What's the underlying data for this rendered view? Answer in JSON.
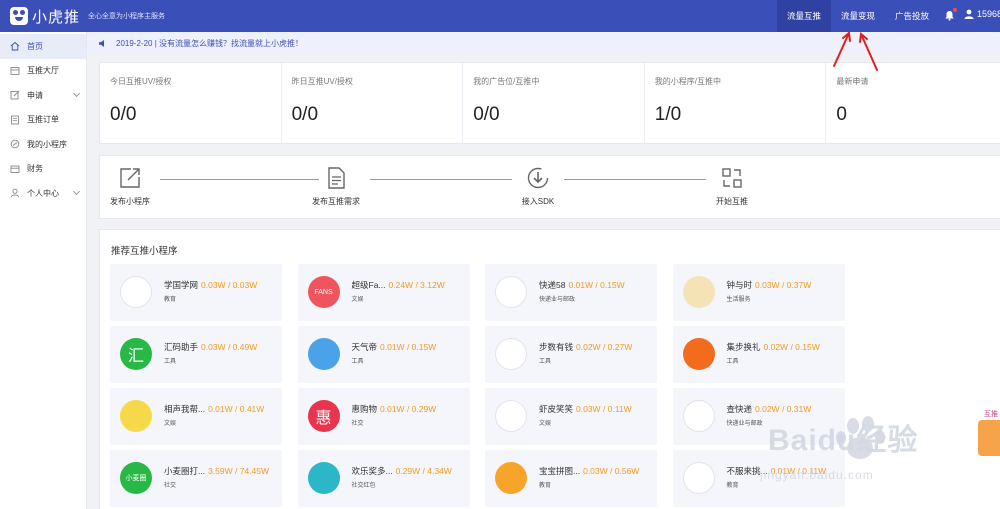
{
  "header": {
    "logo_text": "小虎推",
    "slogan": "全心全意为小程序主服务",
    "nav": [
      "流量互推",
      "流量变现",
      "广告投放"
    ],
    "user_id": "15968"
  },
  "sidebar": {
    "items": [
      {
        "label": "首页",
        "icon": "home-icon"
      },
      {
        "label": "互推大厅",
        "icon": "hall-icon"
      },
      {
        "label": "申请",
        "icon": "edit-icon"
      },
      {
        "label": "互推订单",
        "icon": "order-icon"
      },
      {
        "label": "我的小程序",
        "icon": "miniprogram-icon"
      },
      {
        "label": "财务",
        "icon": "finance-icon"
      },
      {
        "label": "个人中心",
        "icon": "user-icon"
      }
    ]
  },
  "notice": {
    "text": "2019-2-20 | 没有流量怎么赚钱？找流量就上小虎推！"
  },
  "stats": [
    {
      "label": "今日互推UV/授权",
      "value": "0/0"
    },
    {
      "label": "昨日互推UV/授权",
      "value": "0/0"
    },
    {
      "label": "我的广告位/互推中",
      "value": "0/0"
    },
    {
      "label": "我的小程序/互推中",
      "value": "1/0"
    },
    {
      "label": "最新申请",
      "value": "0"
    }
  ],
  "steps": [
    {
      "label": "发布小程序",
      "icon": "publish-icon"
    },
    {
      "label": "发布互推需求",
      "icon": "document-icon"
    },
    {
      "label": "接入SDK",
      "icon": "download-icon"
    },
    {
      "label": "开始互推",
      "icon": "exchange-icon"
    }
  ],
  "recommend": {
    "title": "推荐互推小程序",
    "cards": [
      {
        "name": "学国学网",
        "stats": "0.03W / 0.03W",
        "category": "教育",
        "icon_text": "",
        "color": "#ffffff"
      },
      {
        "name": "超级Fa...",
        "stats": "0.24W / 3.12W",
        "category": "文娱",
        "icon_text": "FANS",
        "color": "#f0555f"
      },
      {
        "name": "快递58",
        "stats": "0.01W / 0.15W",
        "category": "快递业与邮政",
        "icon_text": "",
        "color": "#ffffff"
      },
      {
        "name": "钟与时",
        "stats": "0.03W / 0.37W",
        "category": "生活服务",
        "icon_text": "",
        "color": "#f4e3b5"
      },
      {
        "name": "汇码助手",
        "stats": "0.03W / 0.49W",
        "category": "工具",
        "icon_text": "汇",
        "color": "#27b845"
      },
      {
        "name": "天气帝",
        "stats": "0.01W / 0.15W",
        "category": "工具",
        "icon_text": "",
        "color": "#4aa3e8"
      },
      {
        "name": "步数有钱",
        "stats": "0.02W / 0.27W",
        "category": "工具",
        "icon_text": "",
        "color": "#ffffff"
      },
      {
        "name": "集步换礼",
        "stats": "0.02W / 0.15W",
        "category": "工具",
        "icon_text": "",
        "color": "#f36c1e"
      },
      {
        "name": "相声我帮...",
        "stats": "0.01W / 0.41W",
        "category": "文娱",
        "icon_text": "",
        "color": "#f6d94b"
      },
      {
        "name": "惠购物",
        "stats": "0.01W / 0.29W",
        "category": "社交",
        "icon_text": "惠",
        "color": "#e8344f"
      },
      {
        "name": "虾皮笑笑",
        "stats": "0.03W / 0.11W",
        "category": "文娱",
        "icon_text": "",
        "color": "#ffffff"
      },
      {
        "name": "查快递",
        "stats": "0.02W / 0.31W",
        "category": "快递业与邮政",
        "icon_text": "",
        "color": "#ffffff"
      },
      {
        "name": "小麦圈打...",
        "stats": "3.59W / 74.45W",
        "category": "社交",
        "icon_text": "小麦圈",
        "color": "#27b845"
      },
      {
        "name": "欢乐奖多...",
        "stats": "0.29W / 4.34W",
        "category": "社交红包",
        "icon_text": "",
        "color": "#2bb7c8"
      },
      {
        "name": "宝宝拼图...",
        "stats": "0.03W / 0.56W",
        "category": "教育",
        "icon_text": "",
        "color": "#f6a52a"
      },
      {
        "name": "不服来挑...",
        "stats": "0.01W / 0.11W",
        "category": "教育",
        "icon_text": "",
        "color": "#ffffff"
      }
    ]
  },
  "side_float": {
    "label": "互推"
  },
  "watermark": {
    "text": "Baidu经验",
    "url": "jingyan.baidu.com"
  },
  "colors": {
    "header": "#3b4fb8",
    "accent_orange": "#f39a1e",
    "annotation": "#e02020"
  }
}
